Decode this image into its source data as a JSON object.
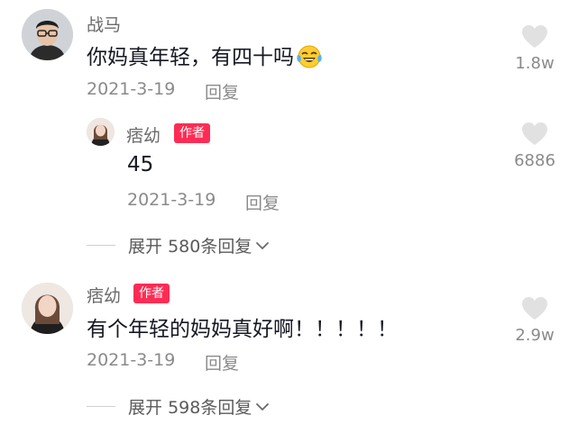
{
  "comments": [
    {
      "username": "战马",
      "text": "你妈真年轻，有四十吗",
      "date": "2021-3-19",
      "reply_label": "回复",
      "likes": "1.8w",
      "emoji": "tears-of-joy-emoji",
      "replies": [
        {
          "username": "痞幼",
          "badge": "作者",
          "text": "45",
          "date": "2021-3-19",
          "reply_label": "回复",
          "likes": "6886"
        }
      ],
      "expand": {
        "prefix": "展开",
        "count": "580",
        "suffix": "条回复"
      }
    },
    {
      "username": "痞幼",
      "badge": "作者",
      "text": "有个年轻的妈妈真好啊！！！！！",
      "date": "2021-3-19",
      "reply_label": "回复",
      "likes": "2.9w",
      "expand": {
        "prefix": "展开",
        "count": "598",
        "suffix": "条回复"
      }
    }
  ],
  "colors": {
    "badge": "#fe2c55",
    "heart": "#e1e1e1",
    "muted": "#8a8a8a"
  },
  "icons": [
    "heart-icon",
    "chevron-down-icon",
    "tears-of-joy-emoji"
  ]
}
